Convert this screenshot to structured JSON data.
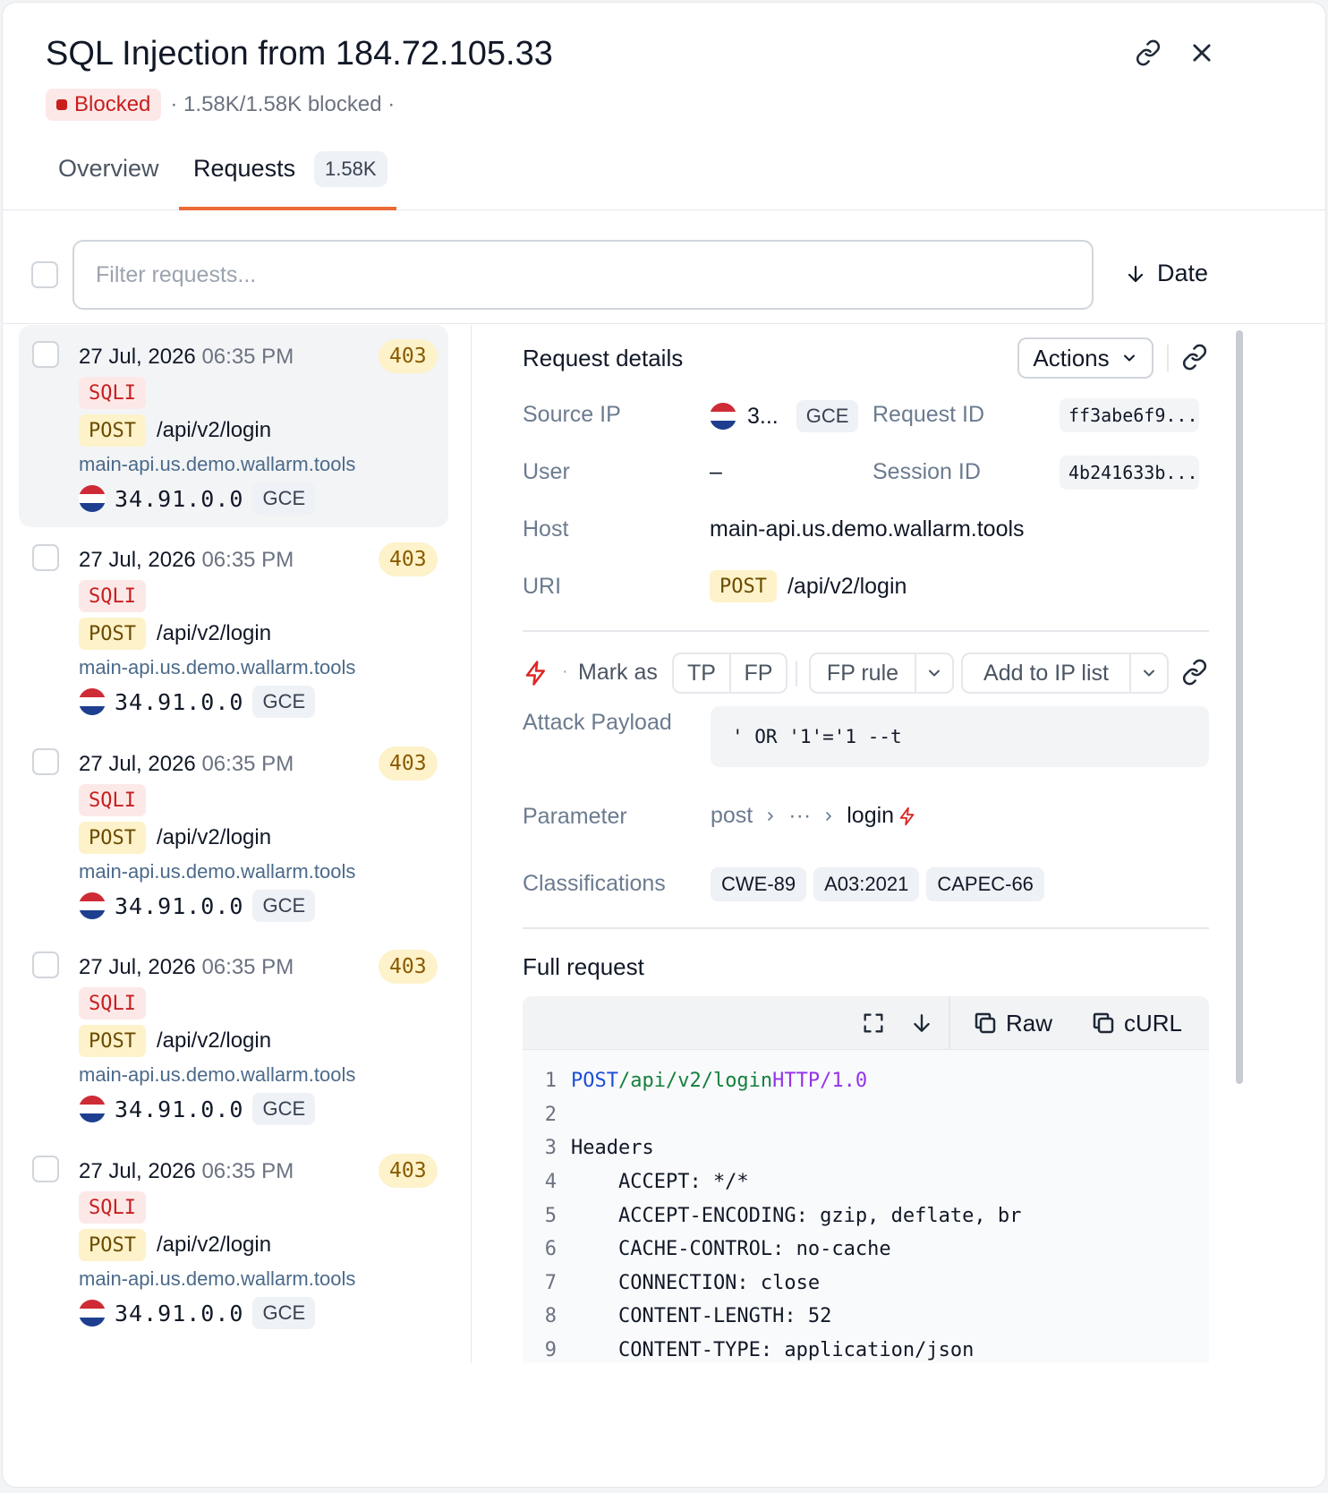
{
  "header": {
    "title": "SQL Injection from 184.72.105.33",
    "status": "Blocked",
    "blocked_meta": "· 1.58K/1.58K blocked ·"
  },
  "tabs": [
    {
      "label": "Overview"
    },
    {
      "label": "Requests",
      "count": "1.58K",
      "active": true
    }
  ],
  "filter": {
    "placeholder": "Filter requests...",
    "sort_label": "Date"
  },
  "requests": [
    {
      "date": "27 Jul, 2026",
      "time": "06:35 PM",
      "code": "403",
      "type": "SQLI",
      "method": "POST",
      "uri": "/api/v2/login",
      "host": "main-api.us.demo.wallarm.tools",
      "ip": "34.91.0.0",
      "provider": "GCE"
    },
    {
      "date": "27 Jul, 2026",
      "time": "06:35 PM",
      "code": "403",
      "type": "SQLI",
      "method": "POST",
      "uri": "/api/v2/login",
      "host": "main-api.us.demo.wallarm.tools",
      "ip": "34.91.0.0",
      "provider": "GCE"
    },
    {
      "date": "27 Jul, 2026",
      "time": "06:35 PM",
      "code": "403",
      "type": "SQLI",
      "method": "POST",
      "uri": "/api/v2/login",
      "host": "main-api.us.demo.wallarm.tools",
      "ip": "34.91.0.0",
      "provider": "GCE"
    },
    {
      "date": "27 Jul, 2026",
      "time": "06:35 PM",
      "code": "403",
      "type": "SQLI",
      "method": "POST",
      "uri": "/api/v2/login",
      "host": "main-api.us.demo.wallarm.tools",
      "ip": "34.91.0.0",
      "provider": "GCE"
    },
    {
      "date": "27 Jul, 2026",
      "time": "06:35 PM",
      "code": "403",
      "type": "SQLI",
      "method": "POST",
      "uri": "/api/v2/login",
      "host": "main-api.us.demo.wallarm.tools",
      "ip": "34.91.0.0",
      "provider": "GCE"
    }
  ],
  "details": {
    "title": "Request details",
    "actions_label": "Actions",
    "source_ip_label": "Source IP",
    "source_ip": "3...",
    "source_provider": "GCE",
    "request_id_label": "Request ID",
    "request_id": "ff3abe6f9...",
    "user_label": "User",
    "user": "–",
    "session_id_label": "Session ID",
    "session_id": "4b241633b...",
    "host_label": "Host",
    "host": "main-api.us.demo.wallarm.tools",
    "uri_label": "URI",
    "uri_method": "POST",
    "uri_path": "/api/v2/login",
    "mark_as_label": "Mark as",
    "tp_label": "TP",
    "fp_label": "FP",
    "fp_rule_label": "FP rule",
    "add_ip_label": "Add to IP list",
    "payload_label": "Attack Payload",
    "payload": "' OR '1'='1 --t",
    "parameter_label": "Parameter",
    "parameter_path": [
      "post",
      "···",
      "login"
    ],
    "classifications_label": "Classifications",
    "classifications": [
      "CWE-89",
      "A03:2021",
      "CAPEC-66"
    ],
    "full_request_label": "Full request",
    "raw_label": "Raw",
    "curl_label": "cURL"
  },
  "full_request": {
    "lines": [
      {
        "n": "1",
        "method": "POST",
        "path": "/api/v2/login",
        "proto": "HTTP/1.0"
      },
      {
        "n": "2",
        "text": ""
      },
      {
        "n": "3",
        "text": "Headers"
      },
      {
        "n": "4",
        "text": "    ACCEPT: */*"
      },
      {
        "n": "5",
        "text": "    ACCEPT-ENCODING: gzip, deflate, br"
      },
      {
        "n": "6",
        "text": "    CACHE-CONTROL: no-cache"
      },
      {
        "n": "7",
        "text": "    CONNECTION: close"
      },
      {
        "n": "8",
        "text": "    CONTENT-LENGTH: 52"
      },
      {
        "n": "9",
        "text": "    CONTENT-TYPE: application/json"
      }
    ]
  },
  "colors": {
    "accent": "#ea6a35",
    "blocked": "#c81e1e",
    "status_403": "#8a5a00",
    "attack_icon": "#dc2626"
  },
  "icons": [
    "link-icon",
    "close-icon",
    "arrow-down-icon",
    "chevron-down-icon",
    "bolt-icon",
    "expand-icon",
    "download-icon",
    "copy-icon",
    "flag-nl-icon"
  ]
}
